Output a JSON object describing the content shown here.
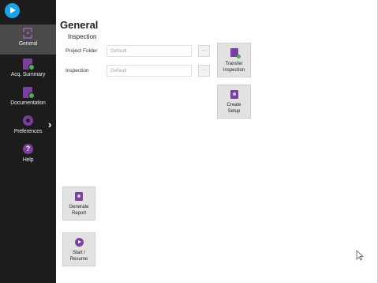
{
  "sidebar": {
    "items": [
      {
        "label": "General",
        "icon": "target-icon"
      },
      {
        "label": "Acq. Summary",
        "icon": "document-icon"
      },
      {
        "label": "Documentation",
        "icon": "document-icon"
      },
      {
        "label": "Preferences",
        "icon": "gear-icon"
      },
      {
        "label": "Help",
        "icon": "help-icon"
      }
    ]
  },
  "main": {
    "title": "General",
    "section": "Inspection",
    "fields": {
      "project_folder": {
        "label": "Project Folder",
        "value": "Default"
      },
      "inspection": {
        "label": "Inspection",
        "value": "Default"
      }
    },
    "browse_label": "...",
    "buttons": {
      "transfer": [
        "Transfer",
        "Inspection"
      ],
      "create": [
        "Create",
        "Setup"
      ],
      "generate": [
        "Generate",
        "Report"
      ],
      "start": [
        "Start /",
        "Resume"
      ]
    }
  },
  "colors": {
    "sidebar_bg": "#1c1c1c",
    "accent": "#7b3fa0",
    "logo": "#1aa3e8",
    "ok": "#4caf50"
  }
}
